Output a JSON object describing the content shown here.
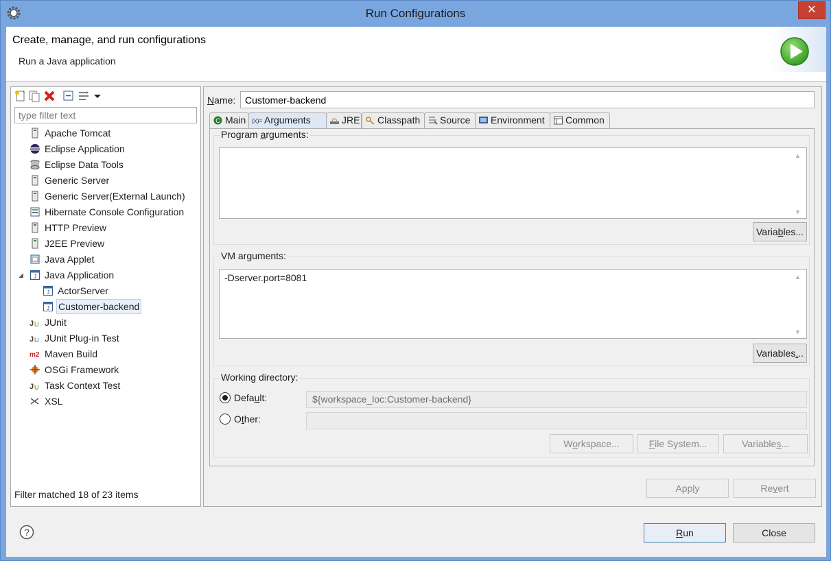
{
  "window": {
    "title": "Run Configurations",
    "close_label": "✕"
  },
  "header": {
    "title": "Create, manage, and run configurations",
    "subtitle": "Run a Java application"
  },
  "filter": {
    "placeholder": "type filter text",
    "status": "Filter matched 18 of 23 items"
  },
  "tree": [
    {
      "label": "Apache Tomcat",
      "icon": "server-icon"
    },
    {
      "label": "Eclipse Application",
      "icon": "eclipse-icon"
    },
    {
      "label": "Eclipse Data Tools",
      "icon": "database-icon"
    },
    {
      "label": "Generic Server",
      "icon": "server-icon"
    },
    {
      "label": "Generic Server(External Launch)",
      "icon": "server-icon"
    },
    {
      "label": "Hibernate Console Configuration",
      "icon": "hibernate-icon"
    },
    {
      "label": "HTTP Preview",
      "icon": "server-icon"
    },
    {
      "label": "J2EE Preview",
      "icon": "server-icon"
    },
    {
      "label": "Java Applet",
      "icon": "applet-icon"
    },
    {
      "label": "Java Application",
      "icon": "java-app-icon",
      "expanded": true
    },
    {
      "label": "ActorServer",
      "icon": "java-app-icon",
      "child": true
    },
    {
      "label": "Customer-backend",
      "icon": "java-app-icon",
      "child": true,
      "selected": true
    },
    {
      "label": "JUnit",
      "icon": "junit-icon"
    },
    {
      "label": "JUnit Plug-in Test",
      "icon": "junit-plugin-icon"
    },
    {
      "label": "Maven Build",
      "icon": "maven-icon"
    },
    {
      "label": "OSGi Framework",
      "icon": "osgi-icon"
    },
    {
      "label": "Task Context Test",
      "icon": "junit-icon"
    },
    {
      "label": "XSL",
      "icon": "xsl-icon"
    }
  ],
  "config": {
    "name_label": "Name:",
    "name_value": "Customer-backend"
  },
  "tabs": [
    {
      "label": "Main",
      "icon": "main-icon"
    },
    {
      "label": "Arguments",
      "icon": "arguments-icon",
      "active": true
    },
    {
      "label": "JRE",
      "icon": "jre-icon"
    },
    {
      "label": "Classpath",
      "icon": "classpath-icon"
    },
    {
      "label": "Source",
      "icon": "source-icon"
    },
    {
      "label": "Environment",
      "icon": "environment-icon"
    },
    {
      "label": "Common",
      "icon": "common-icon"
    }
  ],
  "program_args": {
    "label": "Program arguments:",
    "value": "",
    "variables_label": "Variables..."
  },
  "vm_args": {
    "label": "VM arguments:",
    "value": "-Dserver.port=8081",
    "variables_label": "Variables..."
  },
  "working_dir": {
    "label": "Working directory:",
    "default_label": "Default:",
    "default_value": "${workspace_loc:Customer-backend}",
    "other_label": "Other:",
    "other_value": "",
    "workspace_label": "Workspace...",
    "filesystem_label": "File System...",
    "variables_label": "Variables..."
  },
  "actions": {
    "apply": "Apply",
    "revert": "Revert",
    "run": "Run",
    "close": "Close"
  }
}
